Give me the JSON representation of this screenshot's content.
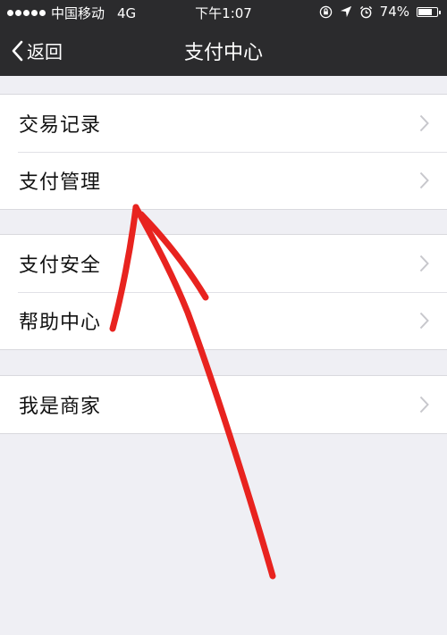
{
  "status_bar": {
    "carrier": "中国移动",
    "network": "4G",
    "time": "下午1:07",
    "battery_text": "74%",
    "battery_level": 0.74
  },
  "nav": {
    "back_label": "返回",
    "title": "支付中心"
  },
  "groups": [
    {
      "items": [
        {
          "label": "交易记录"
        },
        {
          "label": "支付管理"
        }
      ]
    },
    {
      "items": [
        {
          "label": "支付安全"
        },
        {
          "label": "帮助中心"
        }
      ]
    },
    {
      "items": [
        {
          "label": "我是商家"
        }
      ]
    }
  ],
  "colors": {
    "nav_background": "#2b2b2d",
    "page_background": "#efeff4",
    "annotation_stroke": "#e8231f"
  },
  "icons": {
    "back": "chevron-left-icon",
    "row_disclosure": "chevron-right-icon"
  }
}
